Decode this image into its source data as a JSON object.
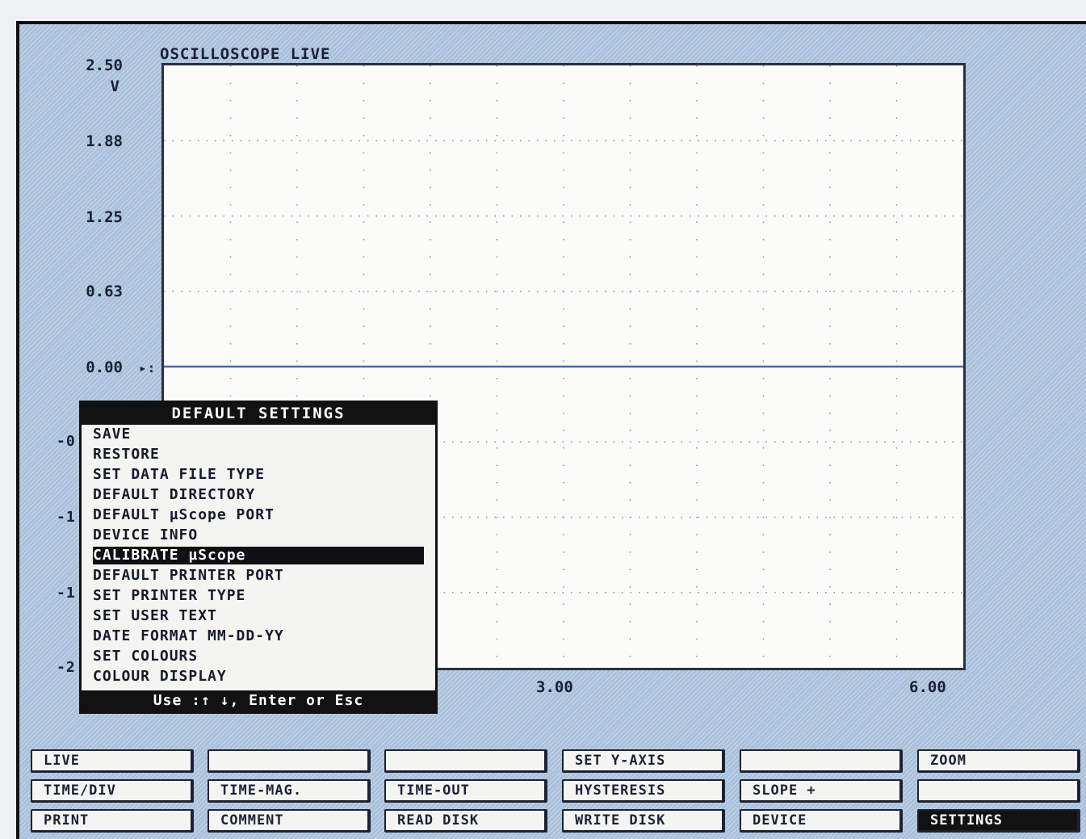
{
  "title": "OSCILLOSCOPE LIVE",
  "y_axis": {
    "unit": "V",
    "ticks": [
      "2.50",
      "1.88",
      "1.25",
      "0.63",
      "0.00"
    ],
    "partial_ticks": [
      "-0",
      "-1",
      "-1",
      "-2"
    ],
    "trigger_marker": "▸:"
  },
  "x_axis": {
    "ticks": [
      "3.00",
      "6.00"
    ]
  },
  "chart_data": {
    "type": "line",
    "title": "OSCILLOSCOPE LIVE",
    "ylabel": "V",
    "ylim": [
      -2.5,
      2.5
    ],
    "xlim": [
      0,
      6
    ],
    "grid": true,
    "series": [
      {
        "x": [
          0,
          6
        ],
        "values": [
          0.0,
          0.0
        ]
      }
    ],
    "trace_color": "#3b6ea8"
  },
  "menu": {
    "title": "DEFAULT SETTINGS",
    "items": [
      "SAVE",
      "RESTORE",
      "SET DATA FILE TYPE",
      "DEFAULT DIRECTORY",
      "DEFAULT µScope PORT",
      "DEVICE INFO",
      "CALIBRATE µScope",
      "DEFAULT PRINTER PORT",
      "SET PRINTER TYPE",
      "SET USER TEXT",
      "DATE FORMAT MM-DD-YY",
      "SET COLOURS",
      "COLOUR DISPLAY"
    ],
    "selected_index": 6,
    "hint": "Use :↑ ↓, Enter or Esc"
  },
  "buttons": {
    "row1": [
      "LIVE",
      "",
      "",
      "SET Y-AXIS",
      "",
      "ZOOM"
    ],
    "row2": [
      "TIME/DIV",
      "TIME-MAG.",
      "TIME-OUT",
      "HYSTERESIS",
      "SLOPE +",
      ""
    ],
    "row3": [
      "PRINT",
      "COMMENT",
      "READ DISK",
      "WRITE DISK",
      "DEVICE",
      "SETTINGS"
    ],
    "active": "SETTINGS"
  },
  "colors": {
    "background": "#a9c0db",
    "plot": "#fbfbfa",
    "trace": "#3b6ea8",
    "menu_highlight": "#0f0f14"
  }
}
